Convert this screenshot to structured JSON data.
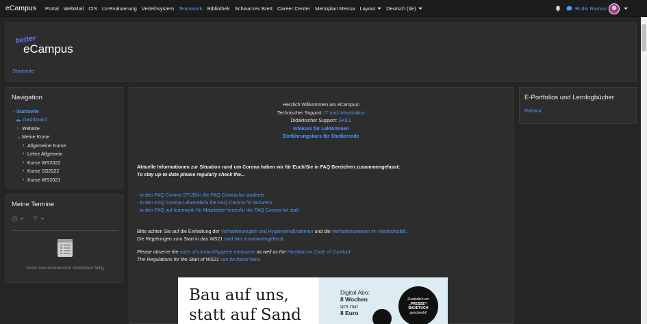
{
  "navbar": {
    "brand": "eCampus",
    "items": [
      "Portal",
      "WebMail",
      "CIS",
      "LV-Evaluierung",
      "Verleihsystem"
    ],
    "teamwork": "Teamwork",
    "items2": [
      "Bibliothek",
      "Schwarzes Brett",
      "Career Center",
      "Menüplan Mensa"
    ],
    "layout": "Layout",
    "language": "Deutsch (de)",
    "user": "Brullo Ramon"
  },
  "header": {
    "logo_better": "better",
    "logo_ecampus": "eCampus",
    "breadcrumb": "Startseite"
  },
  "navigation": {
    "title": "Navigation",
    "items": [
      {
        "label": "Startseite",
        "level": 0,
        "chevron": "down"
      },
      {
        "label": "Dashboard",
        "level": 1,
        "chevron": "icon"
      },
      {
        "label": "Website",
        "level": 1,
        "chevron": "right"
      },
      {
        "label": "Meine Kurse",
        "level": 1,
        "chevron": "down"
      },
      {
        "label": "Allgemeine Kurse",
        "level": 2,
        "chevron": "right"
      },
      {
        "label": "Lehre Allgemein",
        "level": 2,
        "chevron": "right"
      },
      {
        "label": "Kurse WS2022",
        "level": 2,
        "chevron": "right"
      },
      {
        "label": "Kurse SS2022",
        "level": 2,
        "chevron": "right"
      },
      {
        "label": "Kurse WS2021",
        "level": 2,
        "chevron": "right"
      }
    ]
  },
  "termine": {
    "title": "Meine Termine",
    "empty": "Keine bevorstehenden Aktivitäten fällig"
  },
  "eportfolio": {
    "title": "E-Portfolios und Lernlogbücher",
    "link": "Mahara"
  },
  "main": {
    "welcome": "Herzlich Willkommen am eCampus!",
    "tech_label": "Technischer Support:",
    "tech_link": "IT und Infrastruktur",
    "didakt_label": "Didaktischer Support:",
    "didakt_link": "SKILL",
    "info_lektor": "Infokurs für LektorInnen",
    "einf_kurs": "Einführungskurs für Studierende",
    "corona_line1": "Aktuelle Informationen zur Situation rund um Corona haben wir für Euch/Sie in FAQ Bereichen zusammengefasst:",
    "corona_line2": "To stay up-to-date please regularly check the...",
    "faq1": "- in den FAQ Corona STUD/in the FAQ Corona for students",
    "faq2": "- in den FAQ Corona Lehrende/in the FAQ Corona for lecturers",
    "faq3": "- in den FAQ auf teamwork für Mitarbeiter*innen/in the FAQ Corona for staff",
    "rules_a": "Bitte achten Sie auf die Einhaltung der ",
    "rules_link1": "Verhaltensregeln und Hygienemaßnahmen",
    "rules_b": " und die ",
    "rules_link2": "Verhaltensweisen im Verdachtsfall",
    "rules_c": ".",
    "ws21_a": "Die Regelungen zum Start in das WS21 ",
    "ws21_link": "sind hier zusammengefasst",
    "ws21_b": ".",
    "en_a": "Please observe the ",
    "en_link1": "rules of conduct/hygiene measures",
    "en_b": " as well as the ",
    "en_link2": "Handout on Code of Conduct",
    "en_c_a": "The Regulations for the Start of WS21 ",
    "en_c_link": "can be found here",
    "en_c_b": "."
  },
  "ad": {
    "headline1": "Bau auf uns,",
    "headline2": "statt auf Sand",
    "abo1": "Digital Abo:",
    "abo2": "8 Wochen",
    "abo3": "um nur",
    "abo4": "8 Euro",
    "badge1": "Zusätzlich ein",
    "badge2": "„PRESSE\"-",
    "badge3": "BADETUCH",
    "badge4": "geschenkt!"
  }
}
